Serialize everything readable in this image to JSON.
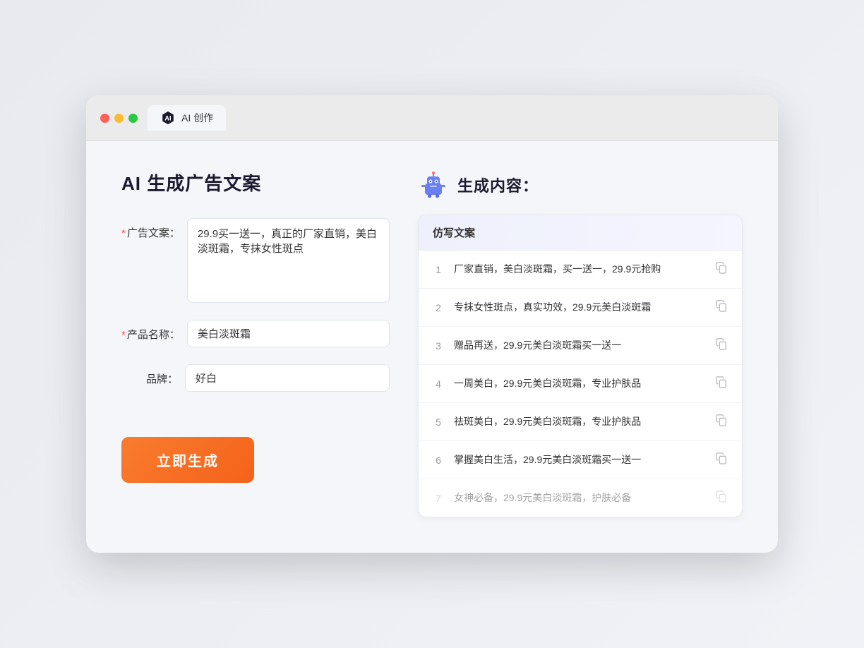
{
  "browser": {
    "tab_label": "AI 创作",
    "traffic_lights": [
      "red",
      "yellow",
      "green"
    ]
  },
  "left_panel": {
    "title": "AI 生成广告文案",
    "form": {
      "ad_copy_label": "广告文案：",
      "ad_copy_required": true,
      "ad_copy_value": "29.9买一送一，真正的厂家直销，美白淡斑霜，专抹女性斑点",
      "product_name_label": "产品名称：",
      "product_name_required": true,
      "product_name_value": "美白淡斑霜",
      "brand_label": "品牌：",
      "brand_required": false,
      "brand_value": "好白"
    },
    "generate_button": "立即生成"
  },
  "right_panel": {
    "title": "生成内容：",
    "results_header": "仿写文案",
    "results": [
      {
        "num": 1,
        "text": "厂家直销，美白淡斑霜，买一送一，29.9元抢购",
        "dimmed": false
      },
      {
        "num": 2,
        "text": "专抹女性斑点，真实功效，29.9元美白淡斑霜",
        "dimmed": false
      },
      {
        "num": 3,
        "text": "赠品再送，29.9元美白淡斑霜买一送一",
        "dimmed": false
      },
      {
        "num": 4,
        "text": "一周美白，29.9元美白淡斑霜，专业护肤品",
        "dimmed": false
      },
      {
        "num": 5,
        "text": "祛斑美白，29.9元美白淡斑霜，专业护肤品",
        "dimmed": false
      },
      {
        "num": 6,
        "text": "掌握美白生活，29.9元美白淡斑霜买一送一",
        "dimmed": false
      },
      {
        "num": 7,
        "text": "女神必备，29.9元美白淡斑霜，护肤必备",
        "dimmed": true
      }
    ]
  }
}
